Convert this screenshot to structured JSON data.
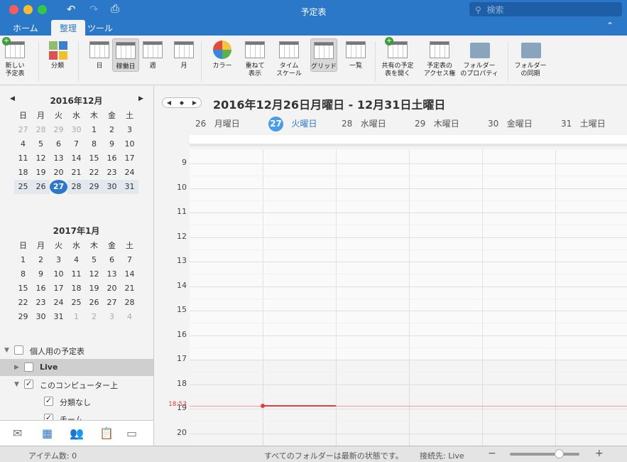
{
  "window": {
    "title": "予定表",
    "search_placeholder": "検索"
  },
  "tabs": [
    {
      "label": "ホーム"
    },
    {
      "label": "整理",
      "active": true
    },
    {
      "label": "ツール"
    }
  ],
  "ribbon": [
    {
      "label": "新しい\n予定表",
      "icon": "new-calendar-icon"
    },
    {
      "label": "分類",
      "icon": "categorize-icon"
    },
    {
      "label": "日",
      "icon": "day-view-icon"
    },
    {
      "label": "稼働日",
      "icon": "work-week-icon",
      "selected": true
    },
    {
      "label": "週",
      "icon": "week-view-icon"
    },
    {
      "label": "月",
      "icon": "month-view-icon"
    },
    {
      "label": "カラー",
      "icon": "color-icon"
    },
    {
      "label": "重ねて\n表示",
      "icon": "overlay-icon"
    },
    {
      "label": "タイム\nスケール",
      "icon": "time-scale-icon"
    },
    {
      "label": "グリッド",
      "icon": "grid-icon",
      "selected": true
    },
    {
      "label": "一覧",
      "icon": "list-icon"
    },
    {
      "label": "共有の予定\n表を開く",
      "icon": "open-shared-calendar-icon"
    },
    {
      "label": "予定表の\nアクセス権",
      "icon": "calendar-permissions-icon"
    },
    {
      "label": "フォルダー\nのプロパティ",
      "icon": "folder-properties-icon"
    },
    {
      "label": "フォルダー\nの同期",
      "icon": "folder-sync-icon"
    }
  ],
  "weekdays": [
    "日",
    "月",
    "火",
    "水",
    "木",
    "金",
    "土"
  ],
  "mini_calendars": [
    {
      "title": "2016年12月",
      "days": [
        [
          "27",
          "28",
          "29",
          "30",
          "1",
          "2",
          "3"
        ],
        [
          "4",
          "5",
          "6",
          "7",
          "8",
          "9",
          "10"
        ],
        [
          "11",
          "12",
          "13",
          "14",
          "15",
          "16",
          "17"
        ],
        [
          "18",
          "19",
          "20",
          "21",
          "22",
          "23",
          "24"
        ],
        [
          "25",
          "26",
          "27",
          "28",
          "29",
          "30",
          "31"
        ]
      ],
      "leading_other": 4,
      "trailing_other": 0,
      "today": "27"
    },
    {
      "title": "2017年1月",
      "days": [
        [
          "1",
          "2",
          "3",
          "4",
          "5",
          "6",
          "7"
        ],
        [
          "8",
          "9",
          "10",
          "11",
          "12",
          "13",
          "14"
        ],
        [
          "15",
          "16",
          "17",
          "18",
          "19",
          "20",
          "21"
        ],
        [
          "22",
          "23",
          "24",
          "25",
          "26",
          "27",
          "28"
        ],
        [
          "29",
          "30",
          "31",
          "1",
          "2",
          "3",
          "4"
        ]
      ],
      "leading_other": 0,
      "trailing_other": 4
    }
  ],
  "folders": [
    {
      "label": "個人用の予定表",
      "checked": false,
      "level": 0,
      "expanded": true
    },
    {
      "label": "Live",
      "checked": false,
      "level": 1,
      "expanded": false,
      "selected": true
    },
    {
      "label": "このコンピューター上",
      "checked": true,
      "level": 1,
      "expanded": true
    },
    {
      "label": "分類なし",
      "checked": true,
      "level": 2
    },
    {
      "label": "チーム",
      "checked": true,
      "level": 2
    }
  ],
  "main": {
    "range_title": "2016年12月26日月曜日 - 12月31日土曜日",
    "days": [
      {
        "num": "26",
        "name": "月曜日"
      },
      {
        "num": "27",
        "name": "火曜日",
        "today": true
      },
      {
        "num": "28",
        "name": "水曜日"
      },
      {
        "num": "29",
        "name": "木曜日"
      },
      {
        "num": "30",
        "name": "金曜日"
      },
      {
        "num": "31",
        "name": "土曜日"
      }
    ],
    "hours": [
      "9",
      "10",
      "11",
      "12",
      "13",
      "14",
      "15",
      "16",
      "17",
      "18",
      "19",
      "20"
    ],
    "current_time": "18:53"
  },
  "status": {
    "items": "アイテム数: 0",
    "sync": "すべてのフォルダーは最新の状態です。",
    "connection": "接続先: Live",
    "zoom_percent": 70
  },
  "colors": {
    "accent": "#2b78c9",
    "now": "#e0403a"
  }
}
